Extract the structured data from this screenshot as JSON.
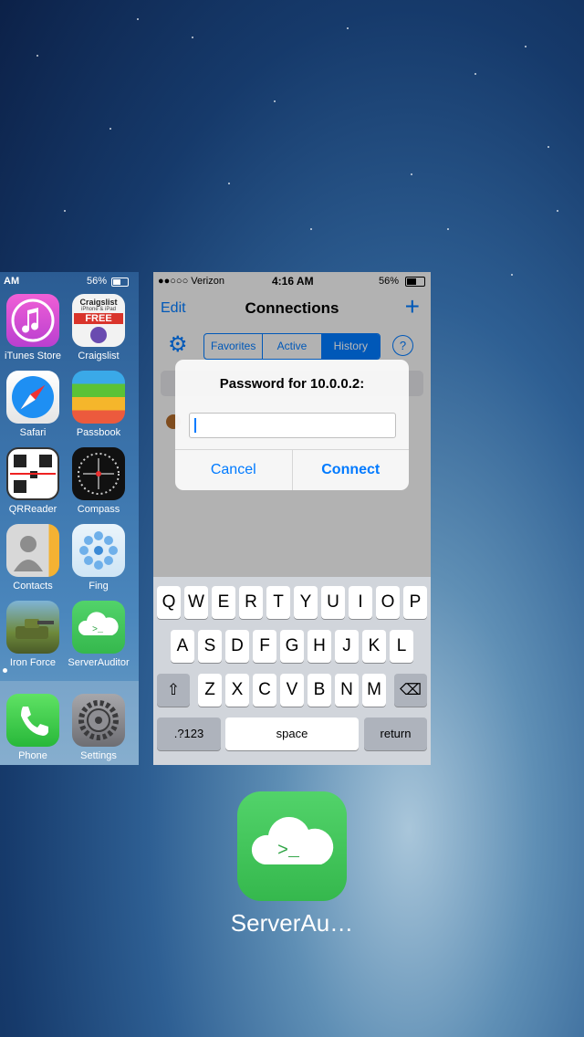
{
  "home_screen": {
    "status": {
      "time": "AM",
      "battery": "56%"
    },
    "apps": [
      {
        "label": "iTunes Store",
        "icon": "itunes-store-icon"
      },
      {
        "label": "Craigslist",
        "icon": "craigslist-icon",
        "badge_top": "Craigslist",
        "badge_sub": "iPhone & iPad",
        "badge_free": "FREE"
      },
      {
        "label": "Safari",
        "icon": "safari-icon"
      },
      {
        "label": "Passbook",
        "icon": "passbook-icon"
      },
      {
        "label": "QRReader",
        "icon": "qrreader-icon"
      },
      {
        "label": "Compass",
        "icon": "compass-icon"
      },
      {
        "label": "Contacts",
        "icon": "contacts-icon"
      },
      {
        "label": "Fing",
        "icon": "fing-icon"
      },
      {
        "label": "Iron Force",
        "icon": "iron-force-icon"
      },
      {
        "label": "ServerAuditor",
        "icon": "serverauditor-icon"
      }
    ],
    "dock": [
      {
        "label": "Phone",
        "icon": "phone-icon"
      },
      {
        "label": "Settings",
        "icon": "settings-icon"
      }
    ]
  },
  "app_card": {
    "status": {
      "carrier": "●●○○○ Verizon",
      "time": "4:16 AM",
      "battery": "56%"
    },
    "nav": {
      "edit": "Edit",
      "title": "Connections",
      "add": "+"
    },
    "tabs": [
      "Favorites",
      "Active",
      "History"
    ],
    "selected_tab": "History",
    "help": "?",
    "alert": {
      "title": "Password for 10.0.0.2:",
      "password_value": "",
      "cancel": "Cancel",
      "connect": "Connect"
    },
    "keyboard": {
      "row1": [
        "Q",
        "W",
        "E",
        "R",
        "T",
        "Y",
        "U",
        "I",
        "O",
        "P"
      ],
      "row2": [
        "A",
        "S",
        "D",
        "F",
        "G",
        "H",
        "J",
        "K",
        "L"
      ],
      "row3": [
        "Z",
        "X",
        "C",
        "V",
        "B",
        "N",
        "M"
      ],
      "numbers": ".?123",
      "space": "space",
      "return": "return"
    }
  },
  "switcher_app": {
    "label": "ServerAu…",
    "icon": "serverauditor-icon",
    "glyph": ">_"
  },
  "colors": {
    "accent": "#007aff",
    "serverauditor_green": "#3cc155"
  }
}
